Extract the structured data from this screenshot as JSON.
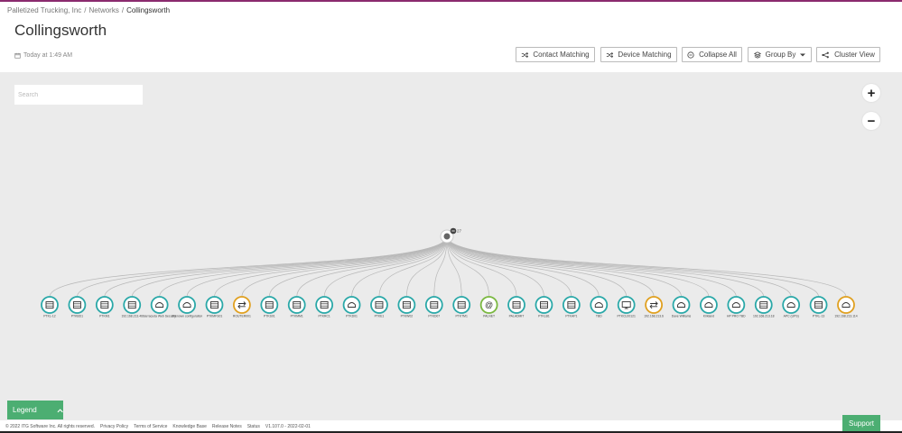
{
  "breadcrumb": {
    "org": "Palletized Trucking, Inc",
    "section": "Networks",
    "current": "Collingsworth"
  },
  "page": {
    "title": "Collingsworth",
    "timestamp": "Today at 1:49 AM"
  },
  "toolbar": {
    "contact_matching": "Contact Matching",
    "device_matching": "Device Matching",
    "collapse_all": "Collapse All",
    "group_by": "Group By",
    "cluster_view": "Cluster View"
  },
  "search": {
    "placeholder": "Search"
  },
  "zoom": {
    "in": "+",
    "out": "−"
  },
  "graph": {
    "hub_count": "27",
    "nodes": [
      {
        "label": "PTKL-12",
        "kind": "server",
        "color": "#2aa8a8"
      },
      {
        "label": "PTKBD1",
        "kind": "server",
        "color": "#2aa8a8"
      },
      {
        "label": "PTKM1",
        "kind": "server",
        "color": "#2aa8a8"
      },
      {
        "label": "192.168.213.46",
        "kind": "server",
        "color": "#2aa8a8"
      },
      {
        "label": "Barracuda Web Security",
        "kind": "printer",
        "color": "#2aa8a8"
      },
      {
        "label": "Unknown configuration",
        "kind": "printer",
        "color": "#2aa8a8"
      },
      {
        "label": "PTKMFS01",
        "kind": "server",
        "color": "#2aa8a8"
      },
      {
        "label": "ROUTER001",
        "kind": "switch",
        "color": "#e0a020"
      },
      {
        "label": "PTKS01",
        "kind": "server",
        "color": "#2aa8a8"
      },
      {
        "label": "PTKMM1",
        "kind": "server",
        "color": "#2aa8a8"
      },
      {
        "label": "PTKRC1",
        "kind": "server",
        "color": "#2aa8a8"
      },
      {
        "label": "PTKD01",
        "kind": "printer",
        "color": "#2aa8a8"
      },
      {
        "label": "PTKE1",
        "kind": "server",
        "color": "#2aa8a8"
      },
      {
        "label": "PTKW02",
        "kind": "server",
        "color": "#2aa8a8"
      },
      {
        "label": "PTKD07",
        "kind": "server",
        "color": "#2aa8a8"
      },
      {
        "label": "PTKTM1",
        "kind": "server",
        "color": "#2aa8a8"
      },
      {
        "label": "PALNET",
        "kind": "at",
        "color": "#7ab840"
      },
      {
        "label": "PALADMIT",
        "kind": "server",
        "color": "#2aa8a8"
      },
      {
        "label": "PTKLB1",
        "kind": "server",
        "color": "#2aa8a8"
      },
      {
        "label": "PTKAP1",
        "kind": "server",
        "color": "#2aa8a8"
      },
      {
        "label": "TBD",
        "kind": "printer",
        "color": "#2aa8a8"
      },
      {
        "label": "PTKCL00121",
        "kind": "monitor",
        "color": "#2aa8a8"
      },
      {
        "label": "192.168.213.6",
        "kind": "switch",
        "color": "#e0a020"
      },
      {
        "label": "Dave Williams",
        "kind": "printer",
        "color": "#2aa8a8"
      },
      {
        "label": "Kirkland",
        "kind": "printer",
        "color": "#2aa8a8"
      },
      {
        "label": "HP PRO TBD",
        "kind": "printer",
        "color": "#2aa8a8"
      },
      {
        "label": "192.168.213.18",
        "kind": "server",
        "color": "#2aa8a8"
      },
      {
        "label": "APC (UPS)",
        "kind": "printer",
        "color": "#2aa8a8"
      },
      {
        "label": "PTKL-13",
        "kind": "server",
        "color": "#2aa8a8"
      },
      {
        "label": "192.168.213.114",
        "kind": "printer",
        "color": "#e0a020"
      }
    ]
  },
  "legend": {
    "label": "Legend"
  },
  "footer": {
    "copyright": "© 2022 ITG Software Inc. All rights reserved.",
    "links": [
      "Privacy Policy",
      "Terms of Service",
      "Knowledge Base",
      "Release Notes",
      "Status"
    ],
    "version": "V1.107.0 - 2022-02-01"
  },
  "support": {
    "label": "Support"
  },
  "colors": {
    "accent": "#8a2a6e",
    "green": "#4cae72",
    "teal": "#2aa8a8",
    "orange": "#e0a020"
  }
}
